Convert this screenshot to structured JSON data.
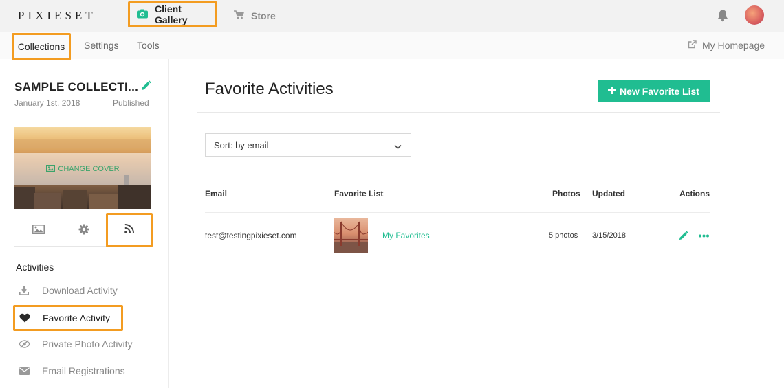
{
  "topbar": {
    "logo": "PIXIESET",
    "nav": [
      {
        "label": "Client Gallery",
        "icon": "camera-icon",
        "active": true
      },
      {
        "label": "Store",
        "icon": "cart-icon",
        "active": false
      }
    ],
    "bell_icon": "bell-icon",
    "avatar": "user-avatar"
  },
  "subnav": {
    "items": [
      "Collections",
      "Settings",
      "Tools"
    ],
    "active": "Collections",
    "homepage_label": "My Homepage",
    "homepage_icon": "external-link-icon"
  },
  "sidebar": {
    "collection_title": "SAMPLE COLLECTI...",
    "collection_date": "January 1st, 2018",
    "collection_status": "Published",
    "change_cover_label": "CHANGE COVER",
    "tabs": [
      "image-icon",
      "gear-icon",
      "rss-feed-icon"
    ],
    "active_tab": "rss-feed-icon",
    "activities_heading": "Activities",
    "activities": [
      {
        "label": "Download Activity",
        "icon": "download-icon",
        "active": false
      },
      {
        "label": "Favorite Activity",
        "icon": "heart-icon",
        "active": true
      },
      {
        "label": "Private Photo Activity",
        "icon": "eye-slash-icon",
        "active": false
      },
      {
        "label": "Email Registrations",
        "icon": "envelope-icon",
        "active": false
      }
    ]
  },
  "main": {
    "title": "Favorite Activities",
    "new_button_label": "New Favorite List",
    "sort_label": "Sort: by email",
    "columns": [
      "Email",
      "Favorite List",
      "Photos",
      "Updated",
      "Actions"
    ],
    "rows": [
      {
        "email": "test@testingpixieset.com",
        "list_name": "My Favorites",
        "photos": "5 photos",
        "updated": "3/15/2018"
      }
    ]
  },
  "colors": {
    "accent": "#20bd91",
    "highlight_border": "#f39c21",
    "topbar_bg": "#f2f2f2"
  }
}
